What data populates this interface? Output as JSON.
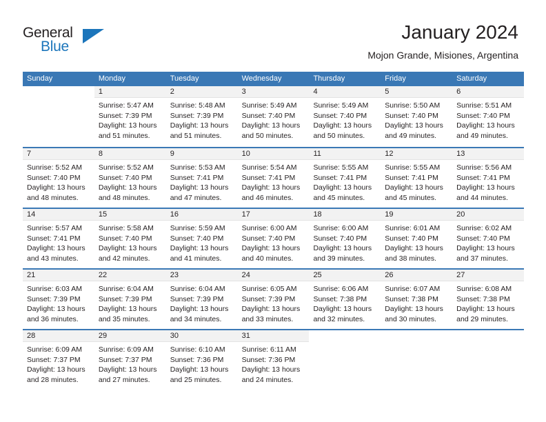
{
  "brand": {
    "name_top": "General",
    "name_bottom": "Blue",
    "accent_color": "#1b75bb"
  },
  "header": {
    "title": "January 2024",
    "location": "Mojon Grande, Misiones, Argentina"
  },
  "calendar": {
    "header_color": "#3a78b5",
    "weekdays": [
      "Sunday",
      "Monday",
      "Tuesday",
      "Wednesday",
      "Thursday",
      "Friday",
      "Saturday"
    ],
    "weeks": [
      [
        {
          "day": "",
          "lines": []
        },
        {
          "day": "1",
          "lines": [
            "Sunrise: 5:47 AM",
            "Sunset: 7:39 PM",
            "Daylight: 13 hours",
            "and 51 minutes."
          ]
        },
        {
          "day": "2",
          "lines": [
            "Sunrise: 5:48 AM",
            "Sunset: 7:39 PM",
            "Daylight: 13 hours",
            "and 51 minutes."
          ]
        },
        {
          "day": "3",
          "lines": [
            "Sunrise: 5:49 AM",
            "Sunset: 7:40 PM",
            "Daylight: 13 hours",
            "and 50 minutes."
          ]
        },
        {
          "day": "4",
          "lines": [
            "Sunrise: 5:49 AM",
            "Sunset: 7:40 PM",
            "Daylight: 13 hours",
            "and 50 minutes."
          ]
        },
        {
          "day": "5",
          "lines": [
            "Sunrise: 5:50 AM",
            "Sunset: 7:40 PM",
            "Daylight: 13 hours",
            "and 49 minutes."
          ]
        },
        {
          "day": "6",
          "lines": [
            "Sunrise: 5:51 AM",
            "Sunset: 7:40 PM",
            "Daylight: 13 hours",
            "and 49 minutes."
          ]
        }
      ],
      [
        {
          "day": "7",
          "lines": [
            "Sunrise: 5:52 AM",
            "Sunset: 7:40 PM",
            "Daylight: 13 hours",
            "and 48 minutes."
          ]
        },
        {
          "day": "8",
          "lines": [
            "Sunrise: 5:52 AM",
            "Sunset: 7:40 PM",
            "Daylight: 13 hours",
            "and 48 minutes."
          ]
        },
        {
          "day": "9",
          "lines": [
            "Sunrise: 5:53 AM",
            "Sunset: 7:41 PM",
            "Daylight: 13 hours",
            "and 47 minutes."
          ]
        },
        {
          "day": "10",
          "lines": [
            "Sunrise: 5:54 AM",
            "Sunset: 7:41 PM",
            "Daylight: 13 hours",
            "and 46 minutes."
          ]
        },
        {
          "day": "11",
          "lines": [
            "Sunrise: 5:55 AM",
            "Sunset: 7:41 PM",
            "Daylight: 13 hours",
            "and 45 minutes."
          ]
        },
        {
          "day": "12",
          "lines": [
            "Sunrise: 5:55 AM",
            "Sunset: 7:41 PM",
            "Daylight: 13 hours",
            "and 45 minutes."
          ]
        },
        {
          "day": "13",
          "lines": [
            "Sunrise: 5:56 AM",
            "Sunset: 7:41 PM",
            "Daylight: 13 hours",
            "and 44 minutes."
          ]
        }
      ],
      [
        {
          "day": "14",
          "lines": [
            "Sunrise: 5:57 AM",
            "Sunset: 7:41 PM",
            "Daylight: 13 hours",
            "and 43 minutes."
          ]
        },
        {
          "day": "15",
          "lines": [
            "Sunrise: 5:58 AM",
            "Sunset: 7:40 PM",
            "Daylight: 13 hours",
            "and 42 minutes."
          ]
        },
        {
          "day": "16",
          "lines": [
            "Sunrise: 5:59 AM",
            "Sunset: 7:40 PM",
            "Daylight: 13 hours",
            "and 41 minutes."
          ]
        },
        {
          "day": "17",
          "lines": [
            "Sunrise: 6:00 AM",
            "Sunset: 7:40 PM",
            "Daylight: 13 hours",
            "and 40 minutes."
          ]
        },
        {
          "day": "18",
          "lines": [
            "Sunrise: 6:00 AM",
            "Sunset: 7:40 PM",
            "Daylight: 13 hours",
            "and 39 minutes."
          ]
        },
        {
          "day": "19",
          "lines": [
            "Sunrise: 6:01 AM",
            "Sunset: 7:40 PM",
            "Daylight: 13 hours",
            "and 38 minutes."
          ]
        },
        {
          "day": "20",
          "lines": [
            "Sunrise: 6:02 AM",
            "Sunset: 7:40 PM",
            "Daylight: 13 hours",
            "and 37 minutes."
          ]
        }
      ],
      [
        {
          "day": "21",
          "lines": [
            "Sunrise: 6:03 AM",
            "Sunset: 7:39 PM",
            "Daylight: 13 hours",
            "and 36 minutes."
          ]
        },
        {
          "day": "22",
          "lines": [
            "Sunrise: 6:04 AM",
            "Sunset: 7:39 PM",
            "Daylight: 13 hours",
            "and 35 minutes."
          ]
        },
        {
          "day": "23",
          "lines": [
            "Sunrise: 6:04 AM",
            "Sunset: 7:39 PM",
            "Daylight: 13 hours",
            "and 34 minutes."
          ]
        },
        {
          "day": "24",
          "lines": [
            "Sunrise: 6:05 AM",
            "Sunset: 7:39 PM",
            "Daylight: 13 hours",
            "and 33 minutes."
          ]
        },
        {
          "day": "25",
          "lines": [
            "Sunrise: 6:06 AM",
            "Sunset: 7:38 PM",
            "Daylight: 13 hours",
            "and 32 minutes."
          ]
        },
        {
          "day": "26",
          "lines": [
            "Sunrise: 6:07 AM",
            "Sunset: 7:38 PM",
            "Daylight: 13 hours",
            "and 30 minutes."
          ]
        },
        {
          "day": "27",
          "lines": [
            "Sunrise: 6:08 AM",
            "Sunset: 7:38 PM",
            "Daylight: 13 hours",
            "and 29 minutes."
          ]
        }
      ],
      [
        {
          "day": "28",
          "lines": [
            "Sunrise: 6:09 AM",
            "Sunset: 7:37 PM",
            "Daylight: 13 hours",
            "and 28 minutes."
          ]
        },
        {
          "day": "29",
          "lines": [
            "Sunrise: 6:09 AM",
            "Sunset: 7:37 PM",
            "Daylight: 13 hours",
            "and 27 minutes."
          ]
        },
        {
          "day": "30",
          "lines": [
            "Sunrise: 6:10 AM",
            "Sunset: 7:36 PM",
            "Daylight: 13 hours",
            "and 25 minutes."
          ]
        },
        {
          "day": "31",
          "lines": [
            "Sunrise: 6:11 AM",
            "Sunset: 7:36 PM",
            "Daylight: 13 hours",
            "and 24 minutes."
          ]
        },
        {
          "day": "",
          "lines": []
        },
        {
          "day": "",
          "lines": []
        },
        {
          "day": "",
          "lines": []
        }
      ]
    ]
  }
}
